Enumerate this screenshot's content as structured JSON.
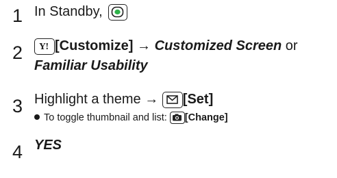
{
  "steps": [
    {
      "number": "1",
      "text": "In Standby,",
      "key_icon": "center-select-key-icon"
    },
    {
      "number": "2",
      "key_icon": "yahoo-key-icon",
      "bracket_text": "[Customize]",
      "arrow": "→",
      "italic_text": "Customized Screen",
      "or_text": "or",
      "italic_text_2": "Familiar Usability"
    },
    {
      "number": "3",
      "text": "Highlight a theme",
      "arrow": "→",
      "key_icon": "mail-key-icon",
      "bracket_text": "[Set]",
      "bullet": {
        "text": "To toggle thumbnail and list:",
        "key_icon": "camera-key-icon",
        "bracket_text": "[Change]"
      }
    },
    {
      "number": "4",
      "italic_text": "YES"
    }
  ]
}
